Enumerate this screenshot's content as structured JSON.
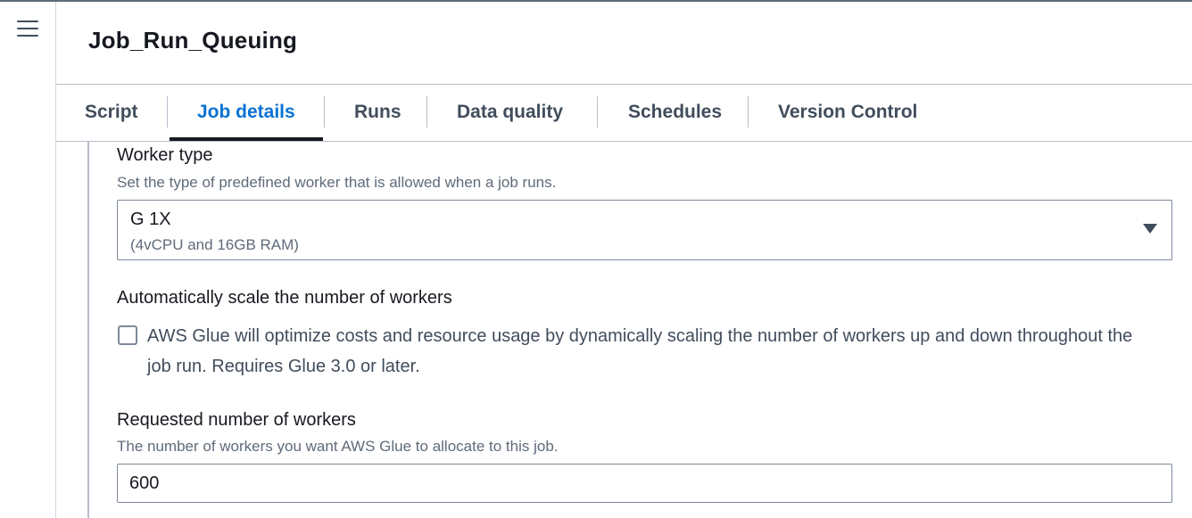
{
  "header": {
    "title": "Job_Run_Queuing"
  },
  "tabs": [
    {
      "label": "Script"
    },
    {
      "label": "Job details",
      "active": true
    },
    {
      "label": "Runs"
    },
    {
      "label": "Data quality"
    },
    {
      "label": "Schedules"
    },
    {
      "label": "Version Control"
    }
  ],
  "worker_type": {
    "label": "Worker type",
    "description": "Set the type of predefined worker that is allowed when a job runs.",
    "selected": "G 1X",
    "selected_detail": "(4vCPU and 16GB RAM)"
  },
  "auto_scale": {
    "label": "Automatically scale the number of workers",
    "checkbox_text": "AWS Glue will optimize costs and resource usage by dynamically scaling the number of workers up and down throughout the job run. Requires Glue 3.0 or later.",
    "checked": false
  },
  "requested_workers": {
    "label": "Requested number of workers",
    "description": "The number of workers you want AWS Glue to allocate to this job.",
    "value": "600"
  },
  "colors": {
    "accent": "#0972d3",
    "text": "#16191f",
    "muted": "#5f6b7a",
    "border": "#7d8998"
  },
  "icons": {
    "menu": "hamburger-menu-icon",
    "select": "caret-down-icon"
  }
}
